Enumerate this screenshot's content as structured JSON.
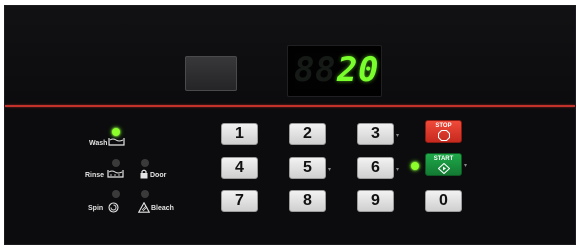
{
  "display": {
    "off_digits": [
      "8",
      "8"
    ],
    "digits": [
      "2",
      "0"
    ],
    "digit_color": "#79ff2c"
  },
  "indicators": [
    {
      "id": "wash",
      "label": "Wash",
      "icon": "wash-tub-icon",
      "lit": true
    },
    {
      "id": "rinse",
      "label": "Rinse",
      "icon": "rinse-tub-icon",
      "lit": false
    },
    {
      "id": "door",
      "label": "Door",
      "icon": "lock-icon",
      "lit": false
    },
    {
      "id": "spin",
      "label": "Spin",
      "icon": "spin-icon",
      "lit": false
    },
    {
      "id": "bleach",
      "label": "Bleach",
      "icon": "bleach-triangle-icon",
      "lit": false
    }
  ],
  "keypad": {
    "keys": [
      "1",
      "2",
      "3",
      "4",
      "5",
      "6",
      "7",
      "8",
      "9",
      "0"
    ]
  },
  "controls": {
    "stop_label": "STOP",
    "start_label": "START",
    "stop_color": "#e0372a",
    "start_color": "#18933f",
    "start_indicator_lit": true
  },
  "colors": {
    "panel": "#0c0c0e",
    "divider": "#c3322a",
    "led_lit": "#8dff2a",
    "led_off": "#3a3a3a"
  }
}
